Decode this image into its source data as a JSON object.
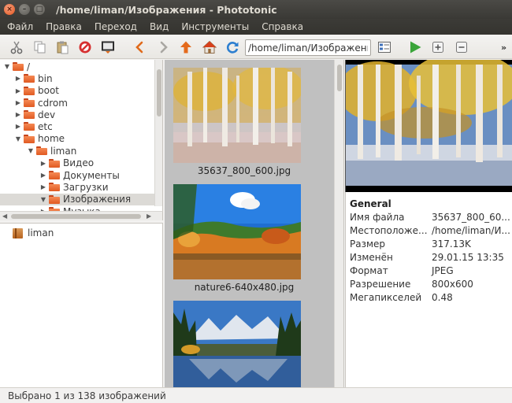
{
  "window": {
    "title": "/home/liman/Изображения - Phototonic"
  },
  "menu": {
    "items": [
      "Файл",
      "Правка",
      "Переход",
      "Вид",
      "Инструменты",
      "Справка"
    ]
  },
  "toolbar": {
    "icons": [
      "cut-icon",
      "copy-icon",
      "paste-icon",
      "delete-icon",
      "save-icon",
      "back-icon",
      "forward-icon",
      "up-icon",
      "home-icon",
      "refresh-icon",
      "view-mode-icon",
      "slideshow-icon",
      "zoom-in-icon",
      "zoom-out-icon"
    ],
    "path_value": "/home/liman/Изображения",
    "overflow": "»",
    "colors": {
      "delete": "#d62f2f",
      "back": "#e06a1b",
      "up": "#e46a1c",
      "refresh": "#2d7fd0",
      "play": "#3aa53a"
    }
  },
  "tree": {
    "items": [
      {
        "label": "/",
        "depth": 0,
        "expanded": true,
        "selected": false
      },
      {
        "label": "bin",
        "depth": 1,
        "expanded": false,
        "selected": false
      },
      {
        "label": "boot",
        "depth": 1,
        "expanded": false,
        "selected": false
      },
      {
        "label": "cdrom",
        "depth": 1,
        "expanded": false,
        "selected": false
      },
      {
        "label": "dev",
        "depth": 1,
        "expanded": false,
        "selected": false
      },
      {
        "label": "etc",
        "depth": 1,
        "expanded": false,
        "selected": false
      },
      {
        "label": "home",
        "depth": 1,
        "expanded": true,
        "selected": false
      },
      {
        "label": "liman",
        "depth": 2,
        "expanded": true,
        "selected": false
      },
      {
        "label": "Видео",
        "depth": 3,
        "expanded": false,
        "selected": false
      },
      {
        "label": "Документы",
        "depth": 3,
        "expanded": false,
        "selected": false
      },
      {
        "label": "Загрузки",
        "depth": 3,
        "expanded": false,
        "selected": false
      },
      {
        "label": "Изображения",
        "depth": 3,
        "expanded": true,
        "selected": true
      },
      {
        "label": "Музыка",
        "depth": 3,
        "expanded": false,
        "selected": false
      }
    ]
  },
  "bookmarks": {
    "items": [
      "liman"
    ]
  },
  "thumbnails": [
    {
      "filename": "35637_800_600.jpg"
    },
    {
      "filename": "nature6-640x480.jpg"
    },
    {
      "filename": ""
    }
  ],
  "info": {
    "heading": "General",
    "rows": [
      {
        "key": "Имя файла",
        "value": "35637_800_60..."
      },
      {
        "key": "Местоположе...",
        "value": "/home/liman/И..."
      },
      {
        "key": "Размер",
        "value": "317.13K"
      },
      {
        "key": "Изменён",
        "value": "29.01.15 13:35"
      },
      {
        "key": "Формат",
        "value": "JPEG"
      },
      {
        "key": "Разрешение",
        "value": "800x600"
      },
      {
        "key": "Мегапикселей",
        "value": "0.48"
      }
    ]
  },
  "status": {
    "text": "Выбрано 1 из 138 изображений"
  }
}
